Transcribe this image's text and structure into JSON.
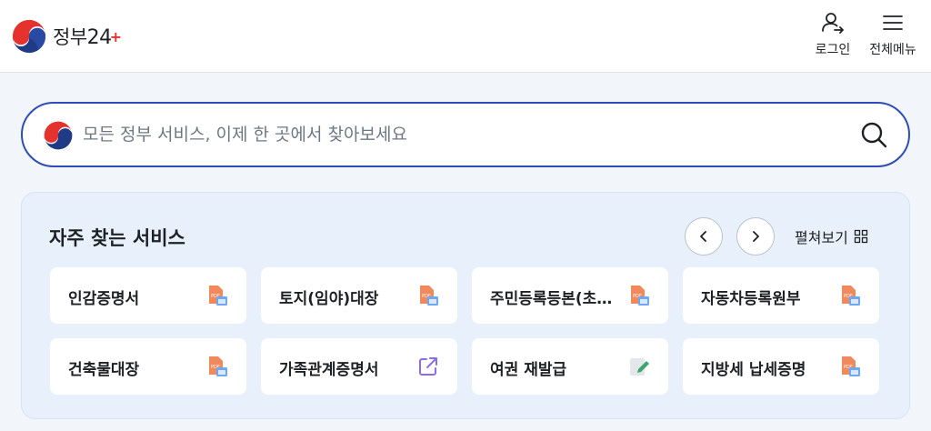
{
  "header": {
    "logo_text": "정부",
    "logo_num": "24",
    "logo_plus": "+",
    "login_label": "로그인",
    "menu_label": "전체메뉴"
  },
  "search": {
    "placeholder": "모든 정부 서비스, 이제 한 곳에서 찾아보세요",
    "value": ""
  },
  "frequent": {
    "title": "자주 찾는 서비스",
    "expand_label": "펼쳐보기",
    "items": [
      {
        "label": "인감증명서",
        "icon": "pdf-document-icon"
      },
      {
        "label": "토지(임야)대장",
        "icon": "pdf-document-icon"
      },
      {
        "label": "주민등록등본(초…",
        "icon": "pdf-document-icon"
      },
      {
        "label": "자동차등록원부",
        "icon": "pdf-document-icon"
      },
      {
        "label": "건축물대장",
        "icon": "pdf-document-icon"
      },
      {
        "label": "가족관계증명서",
        "icon": "external-link-icon"
      },
      {
        "label": "여권 재발급",
        "icon": "edit-document-icon"
      },
      {
        "label": "지방세 납세증명",
        "icon": "pdf-document-icon"
      }
    ]
  },
  "colors": {
    "brand_blue": "#2f4bb8",
    "brand_red": "#e5322d",
    "panel_bg": "#e8f1fb",
    "pdf_orange": "#f08a5d",
    "link_purple": "#8b6cf0",
    "edit_green": "#3fa56a"
  }
}
